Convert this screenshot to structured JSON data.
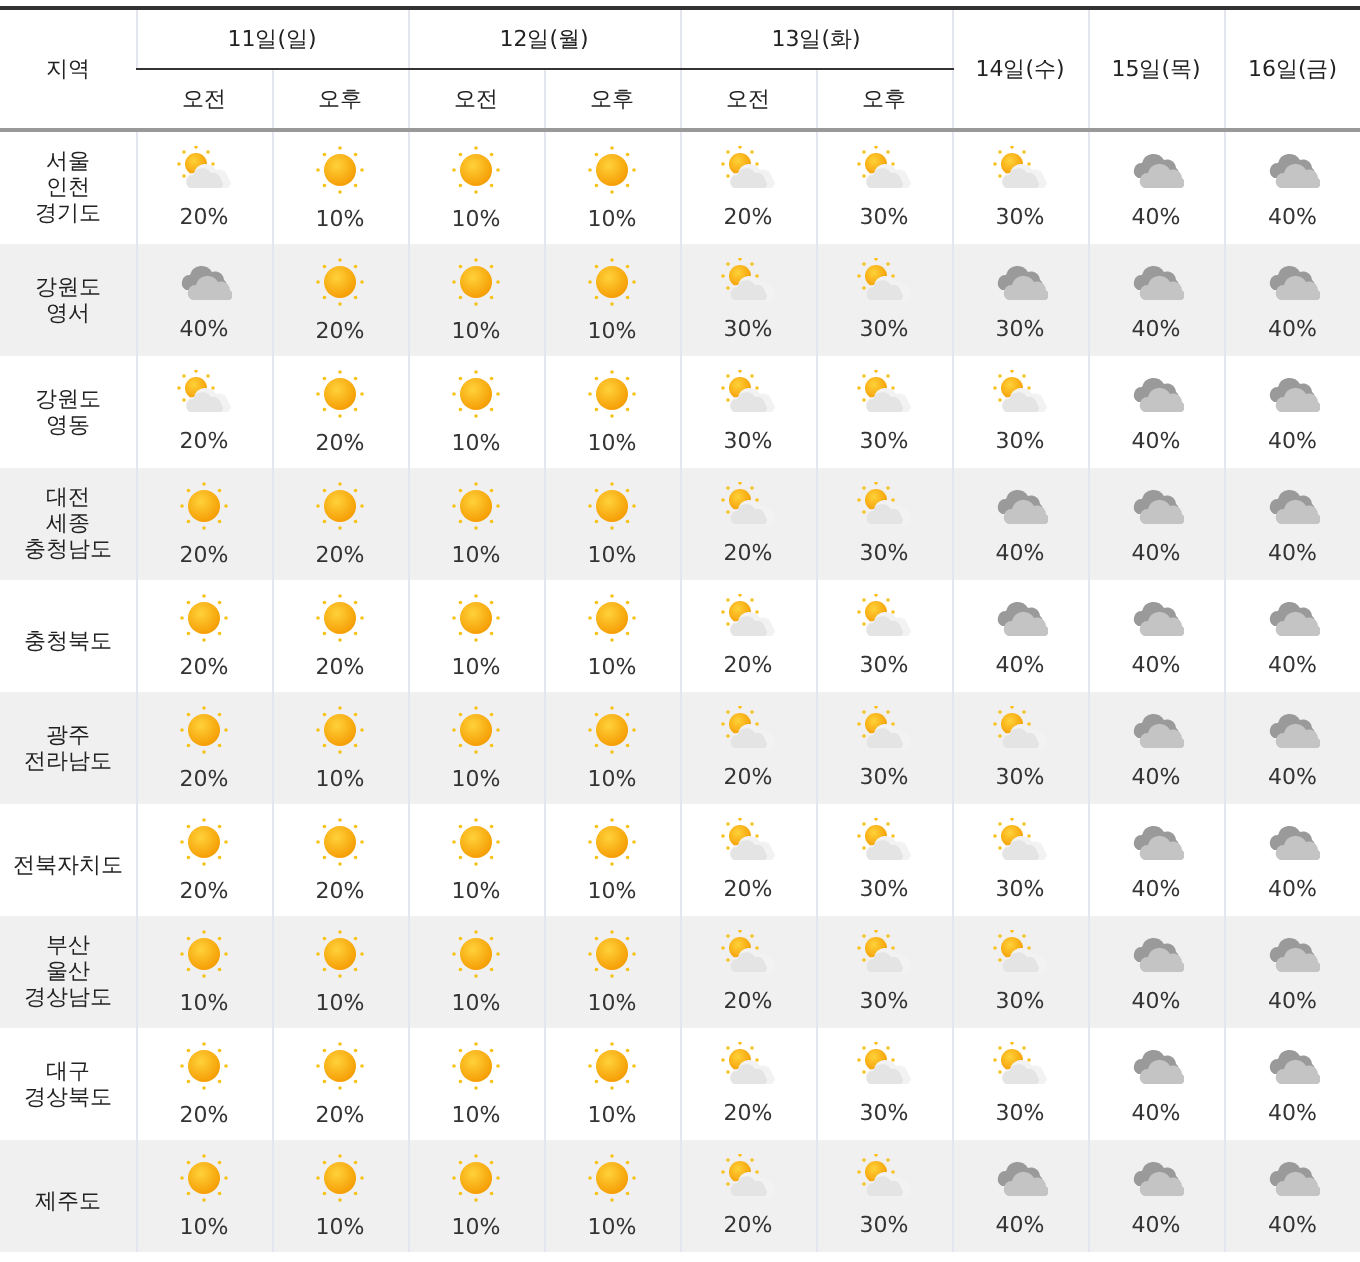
{
  "table": {
    "region_header": "지역",
    "days": [
      {
        "label": "11일(일)",
        "periods": [
          "오전",
          "오후"
        ]
      },
      {
        "label": "12일(월)",
        "periods": [
          "오전",
          "오후"
        ]
      },
      {
        "label": "13일(화)",
        "periods": [
          "오전",
          "오후"
        ]
      },
      {
        "label": "14일(수)"
      },
      {
        "label": "15일(목)"
      },
      {
        "label": "16일(금)"
      }
    ],
    "rows": [
      {
        "region": "서울\n인천\n경기도",
        "cells": [
          {
            "kind": "partly",
            "pop": "20%"
          },
          {
            "kind": "sunny",
            "pop": "10%"
          },
          {
            "kind": "sunny",
            "pop": "10%"
          },
          {
            "kind": "sunny",
            "pop": "10%"
          },
          {
            "kind": "partly",
            "pop": "20%"
          },
          {
            "kind": "partly",
            "pop": "30%"
          },
          {
            "kind": "partly",
            "pop": "30%"
          },
          {
            "kind": "cloudy",
            "pop": "40%"
          },
          {
            "kind": "cloudy",
            "pop": "40%"
          }
        ]
      },
      {
        "region": "강원도\n영서",
        "cells": [
          {
            "kind": "cloudy",
            "pop": "40%"
          },
          {
            "kind": "sunny",
            "pop": "20%"
          },
          {
            "kind": "sunny",
            "pop": "10%"
          },
          {
            "kind": "sunny",
            "pop": "10%"
          },
          {
            "kind": "partly",
            "pop": "30%"
          },
          {
            "kind": "partly",
            "pop": "30%"
          },
          {
            "kind": "cloudy",
            "pop": "30%"
          },
          {
            "kind": "cloudy",
            "pop": "40%"
          },
          {
            "kind": "cloudy",
            "pop": "40%"
          }
        ]
      },
      {
        "region": "강원도\n영동",
        "cells": [
          {
            "kind": "partly",
            "pop": "20%"
          },
          {
            "kind": "sunny",
            "pop": "20%"
          },
          {
            "kind": "sunny",
            "pop": "10%"
          },
          {
            "kind": "sunny",
            "pop": "10%"
          },
          {
            "kind": "partly",
            "pop": "30%"
          },
          {
            "kind": "partly",
            "pop": "30%"
          },
          {
            "kind": "partly",
            "pop": "30%"
          },
          {
            "kind": "cloudy",
            "pop": "40%"
          },
          {
            "kind": "cloudy",
            "pop": "40%"
          }
        ]
      },
      {
        "region": "대전\n세종\n충청남도",
        "cells": [
          {
            "kind": "sunny",
            "pop": "20%"
          },
          {
            "kind": "sunny",
            "pop": "20%"
          },
          {
            "kind": "sunny",
            "pop": "10%"
          },
          {
            "kind": "sunny",
            "pop": "10%"
          },
          {
            "kind": "partly",
            "pop": "20%"
          },
          {
            "kind": "partly",
            "pop": "30%"
          },
          {
            "kind": "cloudy",
            "pop": "40%"
          },
          {
            "kind": "cloudy",
            "pop": "40%"
          },
          {
            "kind": "cloudy",
            "pop": "40%"
          }
        ]
      },
      {
        "region": "충청북도",
        "cells": [
          {
            "kind": "sunny",
            "pop": "20%"
          },
          {
            "kind": "sunny",
            "pop": "20%"
          },
          {
            "kind": "sunny",
            "pop": "10%"
          },
          {
            "kind": "sunny",
            "pop": "10%"
          },
          {
            "kind": "partly",
            "pop": "20%"
          },
          {
            "kind": "partly",
            "pop": "30%"
          },
          {
            "kind": "cloudy",
            "pop": "40%"
          },
          {
            "kind": "cloudy",
            "pop": "40%"
          },
          {
            "kind": "cloudy",
            "pop": "40%"
          }
        ]
      },
      {
        "region": "광주\n전라남도",
        "cells": [
          {
            "kind": "sunny",
            "pop": "20%"
          },
          {
            "kind": "sunny",
            "pop": "10%"
          },
          {
            "kind": "sunny",
            "pop": "10%"
          },
          {
            "kind": "sunny",
            "pop": "10%"
          },
          {
            "kind": "partly",
            "pop": "20%"
          },
          {
            "kind": "partly",
            "pop": "30%"
          },
          {
            "kind": "partly",
            "pop": "30%"
          },
          {
            "kind": "cloudy",
            "pop": "40%"
          },
          {
            "kind": "cloudy",
            "pop": "40%"
          }
        ]
      },
      {
        "region": "전북자치도",
        "cells": [
          {
            "kind": "sunny",
            "pop": "20%"
          },
          {
            "kind": "sunny",
            "pop": "20%"
          },
          {
            "kind": "sunny",
            "pop": "10%"
          },
          {
            "kind": "sunny",
            "pop": "10%"
          },
          {
            "kind": "partly",
            "pop": "20%"
          },
          {
            "kind": "partly",
            "pop": "30%"
          },
          {
            "kind": "partly",
            "pop": "30%"
          },
          {
            "kind": "cloudy",
            "pop": "40%"
          },
          {
            "kind": "cloudy",
            "pop": "40%"
          }
        ]
      },
      {
        "region": "부산\n울산\n경상남도",
        "cells": [
          {
            "kind": "sunny",
            "pop": "10%"
          },
          {
            "kind": "sunny",
            "pop": "10%"
          },
          {
            "kind": "sunny",
            "pop": "10%"
          },
          {
            "kind": "sunny",
            "pop": "10%"
          },
          {
            "kind": "partly",
            "pop": "20%"
          },
          {
            "kind": "partly",
            "pop": "30%"
          },
          {
            "kind": "partly",
            "pop": "30%"
          },
          {
            "kind": "cloudy",
            "pop": "40%"
          },
          {
            "kind": "cloudy",
            "pop": "40%"
          }
        ]
      },
      {
        "region": "대구\n경상북도",
        "cells": [
          {
            "kind": "sunny",
            "pop": "20%"
          },
          {
            "kind": "sunny",
            "pop": "20%"
          },
          {
            "kind": "sunny",
            "pop": "10%"
          },
          {
            "kind": "sunny",
            "pop": "10%"
          },
          {
            "kind": "partly",
            "pop": "20%"
          },
          {
            "kind": "partly",
            "pop": "30%"
          },
          {
            "kind": "partly",
            "pop": "30%"
          },
          {
            "kind": "cloudy",
            "pop": "40%"
          },
          {
            "kind": "cloudy",
            "pop": "40%"
          }
        ]
      },
      {
        "region": "제주도",
        "cells": [
          {
            "kind": "sunny",
            "pop": "10%"
          },
          {
            "kind": "sunny",
            "pop": "10%"
          },
          {
            "kind": "sunny",
            "pop": "10%"
          },
          {
            "kind": "sunny",
            "pop": "10%"
          },
          {
            "kind": "partly",
            "pop": "20%"
          },
          {
            "kind": "partly",
            "pop": "30%"
          },
          {
            "kind": "cloudy",
            "pop": "40%"
          },
          {
            "kind": "cloudy",
            "pop": "40%"
          },
          {
            "kind": "cloudy",
            "pop": "40%"
          }
        ]
      }
    ]
  }
}
